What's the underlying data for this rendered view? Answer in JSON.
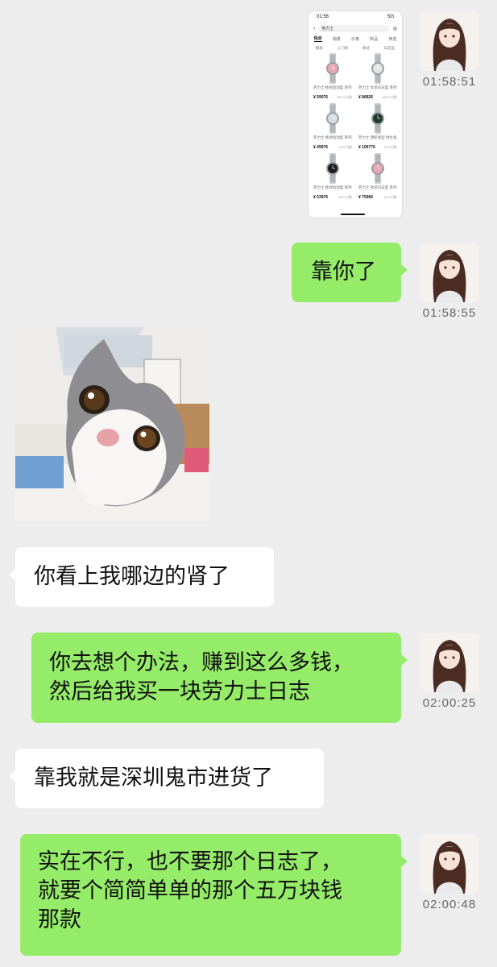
{
  "messages": {
    "m1": {
      "time": "01:58:51"
    },
    "m2": {
      "text": "靠你了",
      "time": "01:58:55"
    },
    "m4": {
      "text": "你看上我哪边的肾了"
    },
    "m5": {
      "line1": "你去想个办法，赚到这么多钱，",
      "line2": "然后给我买一块劳力士日志",
      "time": "02:00:25"
    },
    "m6": {
      "text": "靠我就是深圳鬼市进货了"
    },
    "m7": {
      "line1": "实在不行，也不要那个日志了，",
      "line2": "就要个简简单单的那个五万块钱",
      "line3": "那款",
      "time": "02:00:48"
    }
  },
  "screenshot": {
    "status_time": "01:56",
    "status_right": "5G",
    "search_text": "劳力士",
    "tabs": [
      "综合",
      "销量",
      "价格",
      "新品",
      "筛选"
    ],
    "filters": [
      "腕表",
      "入门款",
      "蚝式",
      "日志型"
    ],
    "products": [
      {
        "title": "劳力士 蚝式恒动型 系列",
        "price": "¥ 59076",
        "sold": "187人付款",
        "dial": "#e9a7b0"
      },
      {
        "title": "劳力士 女装日志型 系列",
        "price": "¥ 86826",
        "sold": "186人付款",
        "dial": "#e5e5e5"
      },
      {
        "title": "劳力士 蚝式恒动型 系列",
        "price": "¥ 49976",
        "sold": "76人付款",
        "dial": "#d8dde2"
      },
      {
        "title": "劳力士 潜航者型 绿水鬼",
        "price": "¥ 106776",
        "sold": "37人付款",
        "dial": "#1f3a2a"
      },
      {
        "title": "劳力士 蚝式恒动型 系列",
        "price": "¥ 53976",
        "sold": "68人付款",
        "dial": "#1c1c1c"
      },
      {
        "title": "劳力士 女装日志型 系列",
        "price": "¥ 75966",
        "sold": "41人付款",
        "dial": "#e9a7b0"
      }
    ]
  },
  "colors": {
    "green_bubble": "#95ec69",
    "white_bubble": "#ffffff",
    "background": "#ededed"
  }
}
